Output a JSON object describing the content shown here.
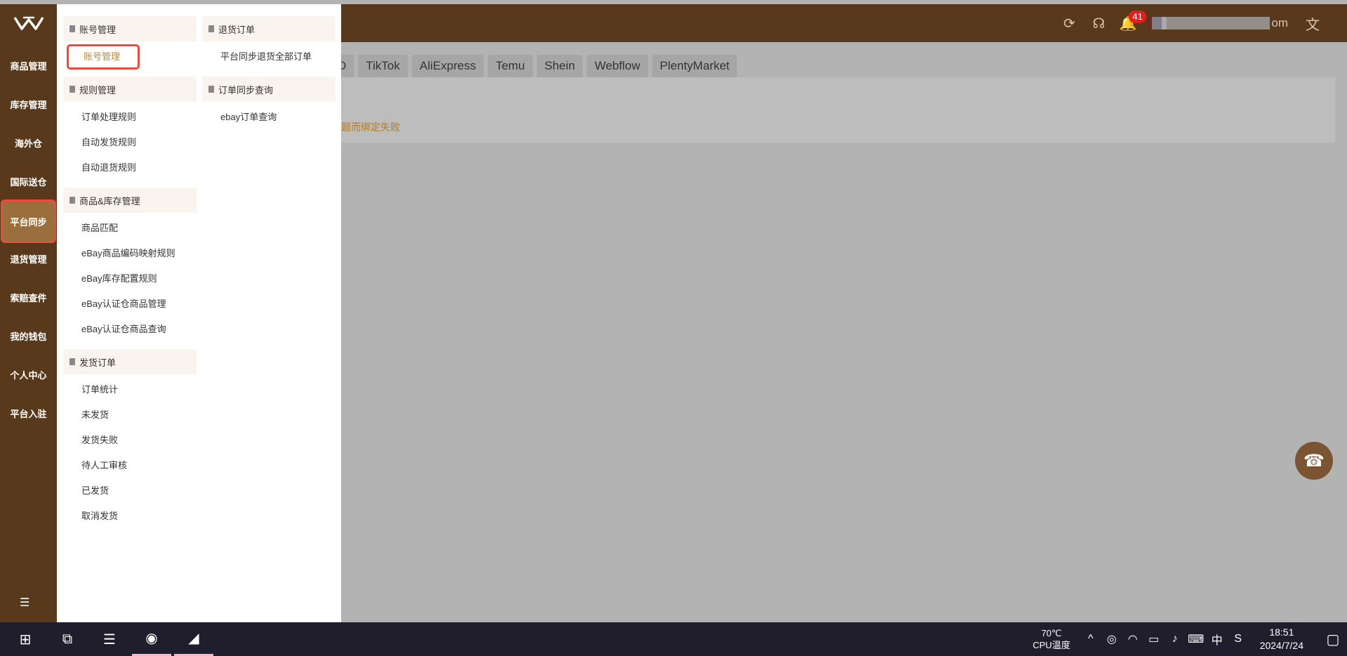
{
  "header": {
    "user_suffix": "om",
    "notification_count": "41",
    "icons": [
      "refresh-icon",
      "headset-icon",
      "bell-icon",
      "translate-icon"
    ]
  },
  "sidebar": {
    "items": [
      {
        "label": "商品管理"
      },
      {
        "label": "库存管理"
      },
      {
        "label": "海外仓"
      },
      {
        "label": "国际送仓"
      },
      {
        "label": "平台同步",
        "active": true
      },
      {
        "label": "退货管理"
      },
      {
        "label": "索赔查件"
      },
      {
        "label": "我的钱包"
      },
      {
        "label": "个人中心"
      },
      {
        "label": "平台入驻"
      }
    ]
  },
  "dropdown": {
    "left_groups": [
      {
        "title": "账号管理",
        "items": [
          "账号管理"
        ]
      },
      {
        "title": "规则管理",
        "items": [
          "订单处理规则",
          "自动发货规则",
          "自动退货规则"
        ]
      },
      {
        "title": "商品&库存管理",
        "items": [
          "商品匹配",
          "eBay商品编码映射规则",
          "eBay库存配置规则",
          "eBay认证仓商品管理",
          "eBay认证仓商品查询"
        ]
      },
      {
        "title": "发货订单",
        "items": [
          "订单统计",
          "未发货",
          "发货失败",
          "待人工审核",
          "已发货",
          "取消发货"
        ]
      }
    ],
    "right_groups": [
      {
        "title": "退货订单",
        "items": [
          "平台同步退货全部订单"
        ]
      },
      {
        "title": "订单同步查询",
        "items": [
          "ebay订单查询"
        ]
      }
    ]
  },
  "platform_tabs": [
    "D",
    "TikTok",
    "AliExpress",
    "Temu",
    "Shein",
    "Webflow",
    "PlentyMarket"
  ],
  "content": {
    "warning_fragment": "题而绑定失败"
  },
  "taskbar": {
    "cpu_temp": "70℃",
    "cpu_label": "CPU温度",
    "ime": "中",
    "time": "18:51",
    "date": "2024/7/24"
  },
  "colors": {
    "header_bg": "#59391b",
    "active_item": "#9b6f3b",
    "highlight_border": "#e74c3c",
    "link_orange": "#c0892f"
  }
}
